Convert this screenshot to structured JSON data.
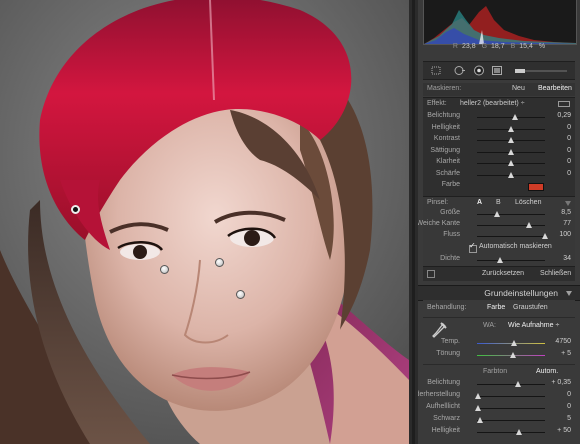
{
  "histogram": {
    "r_label": "R",
    "r_value": "23,8",
    "g_label": "G",
    "g_value": "18,7",
    "b_label": "B",
    "b_value": "15,4",
    "unit": "%"
  },
  "mask": {
    "label": "Maskieren:",
    "neu": "Neu",
    "bearbeiten": "Bearbeiten"
  },
  "effect": {
    "label": "Effekt:",
    "preset": "heller2 (bearbeitet) ÷",
    "sliders": [
      {
        "label": "Belichtung",
        "value": "0,29",
        "pos": 0.56
      },
      {
        "label": "Helligkeit",
        "value": "0",
        "pos": 0.5
      },
      {
        "label": "Kontrast",
        "value": "0",
        "pos": 0.5
      },
      {
        "label": "Sättigung",
        "value": "0",
        "pos": 0.5
      },
      {
        "label": "Klarheit",
        "value": "0",
        "pos": 0.5
      },
      {
        "label": "Schärfe",
        "value": "0",
        "pos": 0.5
      }
    ],
    "farbe_label": "Farbe",
    "farbe_color": "#cf3c27"
  },
  "pinsel": {
    "label": "Pinsel:",
    "a": "A",
    "b": "B",
    "loeschen": "Löschen",
    "sliders": [
      {
        "label": "Größe",
        "value": "8,5",
        "pos": 0.3
      },
      {
        "label": "Weiche Kante",
        "value": "77",
        "pos": 0.77
      },
      {
        "label": "Fluss",
        "value": "100",
        "pos": 1.0
      }
    ],
    "auto_mask": "Automatisch maskieren",
    "auto_mask_checked": true,
    "dichte": {
      "label": "Dichte",
      "value": "34",
      "pos": 0.34
    }
  },
  "buttons": {
    "reset": "Zurücksetzen",
    "close": "Schließen"
  },
  "grund": {
    "title": "Grundeinstellungen",
    "behandlung": "Behandlung:",
    "farbe": "Farbe",
    "graustufen": "Graustufen",
    "wa_label": "WA:",
    "wa_value": "Wie Aufnahme ÷",
    "temp": {
      "label": "Temp.",
      "value": "4750",
      "pos": 0.55
    },
    "toenung": {
      "label": "Tönung",
      "value": "+ 5",
      "pos": 0.53
    },
    "farbton": "Farbton",
    "autom": "Autom.",
    "sliders": [
      {
        "label": "Belichtung",
        "value": "+ 0,35",
        "pos": 0.6
      },
      {
        "label": "Wiederherstellung",
        "value": "0",
        "pos": 0.02
      },
      {
        "label": "Aufhelllicht",
        "value": "0",
        "pos": 0.02
      },
      {
        "label": "Schwarz",
        "value": "5",
        "pos": 0.05
      },
      {
        "label": "Helligkeit",
        "value": "+ 50",
        "pos": 0.62
      }
    ]
  },
  "colors": {
    "accent_red": "#cf3c27",
    "panel_bg": "#3a3a3a",
    "dark_bg": "#2f2f2f"
  }
}
